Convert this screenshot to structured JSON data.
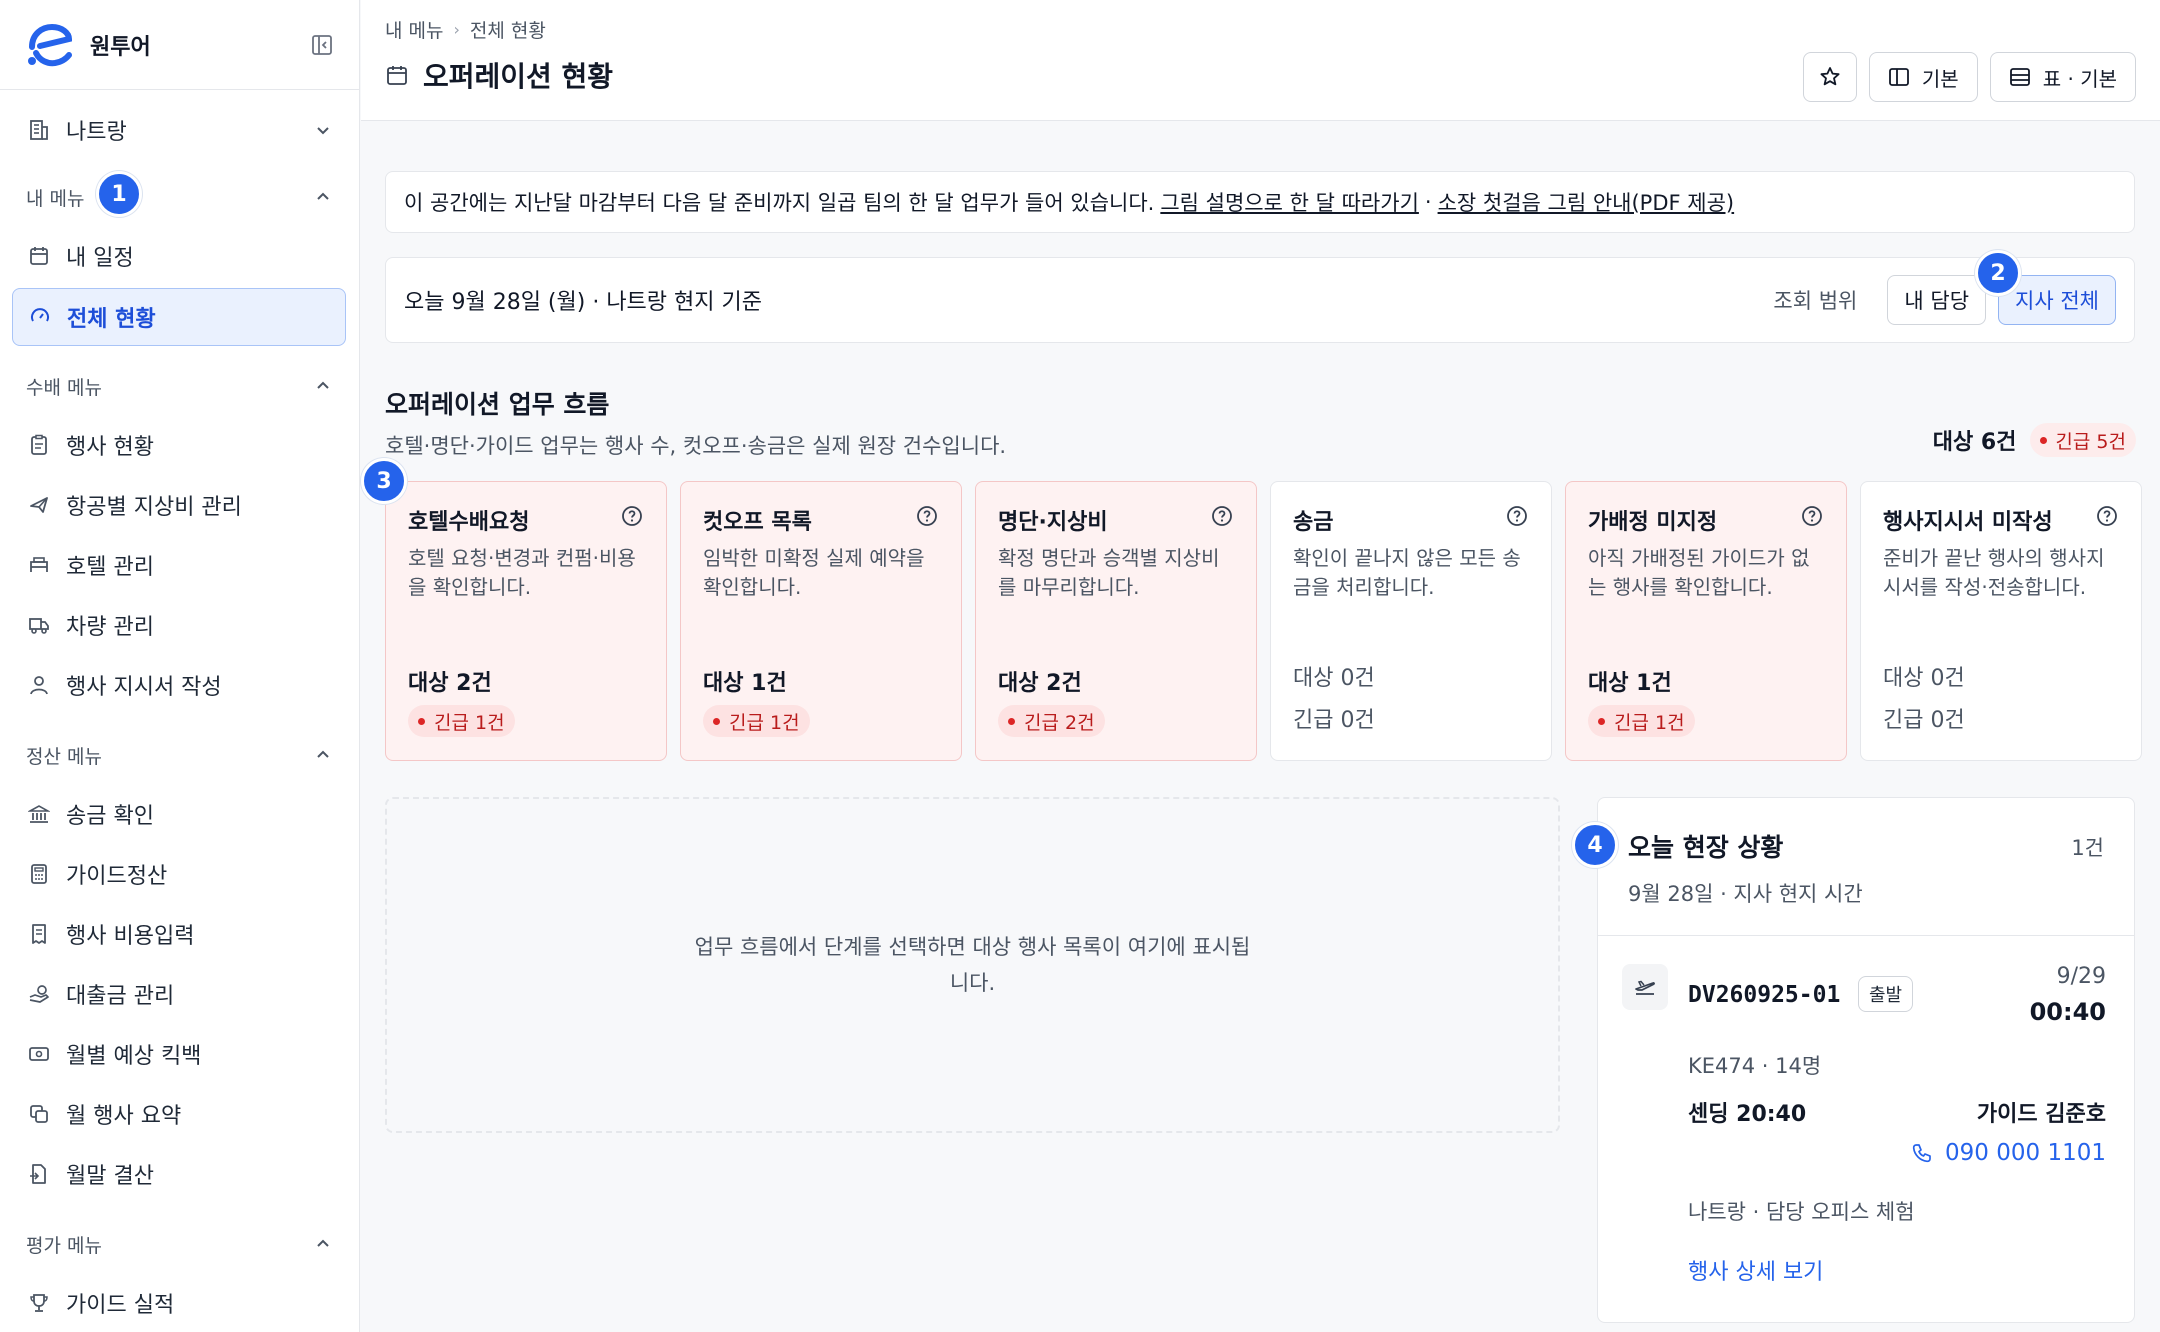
{
  "brand": {
    "name": "원투어"
  },
  "sidebar": {
    "branch": "나트랑",
    "sections": {
      "my_menu": "내 메뉴",
      "arrangement": "수배 메뉴",
      "settlement": "정산 메뉴",
      "evaluation": "평가 메뉴"
    },
    "items": {
      "my_schedule": "내 일정",
      "overview": "전체 현황",
      "event_status": "행사 현황",
      "airline_allowance": "항공별 지상비 관리",
      "hotel": "호텔 관리",
      "vehicle": "차량 관리",
      "instruction": "행사 지시서 작성",
      "remittance": "송금 확인",
      "guide_settlement": "가이드정산",
      "event_cost": "행사 비용입력",
      "loan": "대출금 관리",
      "kickback": "월별 예상 킥백",
      "monthly_summary": "월 행사 요약",
      "month_end": "월말 결산",
      "guide_performance": "가이드 실적"
    }
  },
  "badges": [
    "1",
    "2",
    "3",
    "4"
  ],
  "header": {
    "breadcrumb": [
      "내 메뉴",
      "전체 현황"
    ],
    "title": "오퍼레이션 현황",
    "view_basic": "기본",
    "table_basic": "표 · 기본"
  },
  "notice": {
    "text": "이 공간에는 지난달 마감부터 다음 달 준비까지 일곱 팀의 한 달 업무가 들어 있습니다.",
    "link1": "그림 설명으로 한 달 따라가기",
    "sep": "·",
    "link2": "소장 첫걸음 그림 안내(PDF 제공)"
  },
  "datebar": {
    "date": "오늘 9월 28일 (월) · 나트랑 현지 기준",
    "scope_label": "조회 범위",
    "scope_mine": "내 담당",
    "scope_all": "지사 전체"
  },
  "flow": {
    "title": "오퍼레이션 업무 흐름",
    "subtitle": "호텔·명단·가이드 업무는 행사 수, 컷오프·송금은 실제 원장 건수입니다.",
    "total": "대상 6건",
    "urgent": "긴급 5건",
    "cards": [
      {
        "title": "호텔수배요청",
        "desc": "호텔 요청·변경과 컨펌·비용을 확인합니다.",
        "target": "대상 2건",
        "urgent": "긴급 1건",
        "hot": true
      },
      {
        "title": "컷오프 목록",
        "desc": "임박한 미확정 실제 예약을 확인합니다.",
        "target": "대상 1건",
        "urgent": "긴급 1건",
        "hot": true
      },
      {
        "title": "명단·지상비",
        "desc": "확정 명단과 승객별 지상비를 마무리합니다.",
        "target": "대상 2건",
        "urgent": "긴급 2건",
        "hot": true
      },
      {
        "title": "송금",
        "desc": "확인이 끝나지 않은 모든 송금을 처리합니다.",
        "target": "대상 0건",
        "urgent": "긴급 0건",
        "hot": false
      },
      {
        "title": "가배정 미지정",
        "desc": "아직 가배정된 가이드가 없는 행사를 확인합니다.",
        "target": "대상 1건",
        "urgent": "긴급 1건",
        "hot": true
      },
      {
        "title": "행사지시서 미작성",
        "desc": "준비가 끝난 행사의 행사지시서를 작성·전송합니다.",
        "target": "대상 0건",
        "urgent": "긴급 0건",
        "hot": false
      }
    ]
  },
  "empty": {
    "text": "업무 흐름에서 단계를 선택하면 대상 행사 목록이 여기에 표시됩니다."
  },
  "today": {
    "title": "오늘 현장 상황",
    "count": "1건",
    "date": "9월 28일 · 지사 현지 시간",
    "event": {
      "code": "DV260925-01",
      "tag": "출발",
      "date": "9/29",
      "time": "00:40",
      "flight": "KE474 · 14명",
      "sending": "센딩 20:40",
      "guide": "가이드 김준호",
      "phone": "090 000 1101",
      "place": "나트랑 · 담당 오피스 체험",
      "link": "행사 상세 보기"
    }
  },
  "colors": {
    "accent": "#2563eb",
    "urgent": "#dc2626",
    "hot_card": "#fef2f2"
  }
}
